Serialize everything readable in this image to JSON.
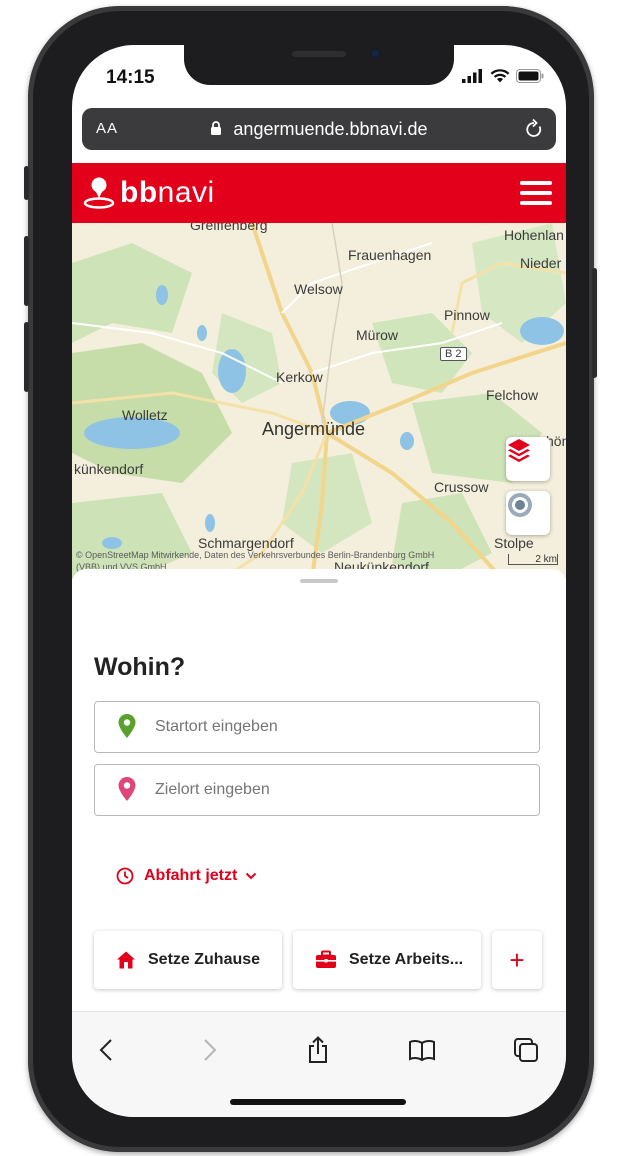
{
  "status": {
    "time": "14:15"
  },
  "browser": {
    "text_size_label": "AA",
    "url": "angermuende.bbnavi.de"
  },
  "app": {
    "logo_bold": "bb",
    "logo_light": "navi",
    "brand_color": "#e2001a"
  },
  "map": {
    "places": {
      "greiffenberg": "Greiffenberg",
      "hohenlandin": "Hohenlan",
      "frauenhagen": "Frauenhagen",
      "nieder": "Nieder",
      "welsow": "Welsow",
      "pinnow": "Pinnow",
      "murow": "Mürow",
      "b2": "B 2",
      "kerkow": "Kerkow",
      "felchow": "Felchow",
      "wolletz": "Wolletz",
      "angermuende": "Angermünde",
      "kuenkendorf": "künkendorf",
      "schoen": "hön",
      "crussow": "Crussow",
      "schmargendorf": "Schmargendorf",
      "stolpe": "Stolpe",
      "neukuenkendorf": "Neukünkendorf"
    },
    "attribution_line1": "© OpenStreetMap Mitwirkende, Daten des Verkehrsverbundes Berlin-Brandenburg GmbH",
    "attribution_line2": "(VBB) und VVS GmbH",
    "scale_label": "2 km",
    "layers_icon": "layers-icon",
    "locate_icon": "locate-icon"
  },
  "plan": {
    "heading": "Wohin?",
    "start_placeholder": "Startort eingeben",
    "destination_placeholder": "Zielort eingeben",
    "departure_label": "Abfahrt jetzt",
    "home_label": "Setze Zuhause",
    "work_label": "Setze Arbeits...",
    "add_label": "+"
  },
  "toolbar": {
    "icons": [
      "back-icon",
      "forward-icon",
      "share-icon",
      "bookmarks-icon",
      "tabs-icon"
    ]
  }
}
